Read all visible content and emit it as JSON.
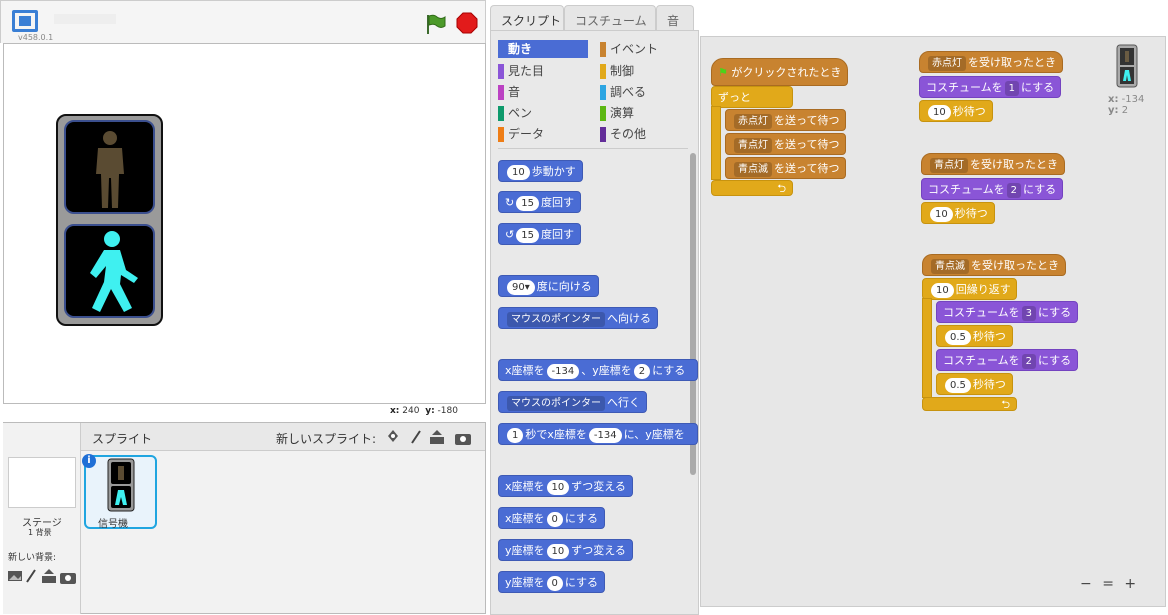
{
  "header": {
    "version": "v458.0.1",
    "flag_icon": "green-flag-icon",
    "stop_icon": "stop-sign-icon"
  },
  "stage": {
    "coords_x_label": "x:",
    "coords_x": "240",
    "coords_y_label": "y:",
    "coords_y": "-180"
  },
  "sprites": {
    "label": "スプライト",
    "new_sprite": "新しいスプライト:",
    "stage_name": "ステージ",
    "stage_count": "1 背景",
    "new_bg": "新しい背景:",
    "items": [
      {
        "name": "信号機"
      }
    ]
  },
  "tabs": [
    {
      "label": "スクリプト"
    },
    {
      "label": "コスチューム"
    },
    {
      "label": "音"
    }
  ],
  "categories": [
    {
      "label": "動き",
      "color": "#4a6cd4"
    },
    {
      "label": "見た目",
      "color": "#8a55d7"
    },
    {
      "label": "音",
      "color": "#bb42c3"
    },
    {
      "label": "ペン",
      "color": "#0e9a6c"
    },
    {
      "label": "データ",
      "color": "#ee7d16"
    },
    {
      "label": "イベント",
      "color": "#c88330"
    },
    {
      "label": "制御",
      "color": "#e1a91a"
    },
    {
      "label": "調べる",
      "color": "#2ca5e2"
    },
    {
      "label": "演算",
      "color": "#5cb712"
    },
    {
      "label": "その他",
      "color": "#632d99"
    }
  ],
  "palette": {
    "move": {
      "v": "10",
      "t": "歩動かす"
    },
    "turn_cw": {
      "v": "15",
      "t": "度回す"
    },
    "turn_ccw": {
      "v": "15",
      "t": "度回す"
    },
    "point_dir": {
      "v": "90▾",
      "t": "度に向ける"
    },
    "point_to": {
      "v": "マウスのポインター",
      "t": "へ向ける"
    },
    "goto_xy": {
      "t1": "x座標を",
      "x": "-134",
      "t2": "、y座標を",
      "y": "2",
      "t3": "にする"
    },
    "goto": {
      "v": "マウスのポインター",
      "t": "へ行く"
    },
    "glide": {
      "s": "1",
      "t1": "秒でx座標を",
      "x": "-134",
      "t2": "に、y座標を"
    },
    "change_x": {
      "t1": "x座標を",
      "v": "10",
      "t2": "ずつ変える"
    },
    "set_x": {
      "t1": "x座標を",
      "v": "0",
      "t2": "にする"
    },
    "change_y": {
      "t1": "y座標を",
      "v": "10",
      "t2": "ずつ変える"
    },
    "set_y": {
      "t1": "y座標を",
      "v": "0",
      "t2": "にする"
    }
  },
  "scripts": {
    "flag_hat": "がクリックされたとき",
    "forever": "ずっと",
    "bcast1": {
      "msg": "赤点灯",
      "t": "を送って待つ"
    },
    "bcast2": {
      "msg": "青点灯",
      "t": "を送って待つ"
    },
    "bcast3": {
      "msg": "青点滅",
      "t": "を送って待つ"
    },
    "s2": {
      "hat_msg": "赤点灯",
      "hat_t": "を受け取ったとき",
      "cos_t1": "コスチュームを",
      "cos_v": "1",
      "cos_t2": "にする",
      "wait_v": "10",
      "wait_t": "秒待つ"
    },
    "s3": {
      "hat_msg": "青点灯",
      "hat_t": "を受け取ったとき",
      "cos_t1": "コスチュームを",
      "cos_v": "2",
      "cos_t2": "にする",
      "wait_v": "10",
      "wait_t": "秒待つ"
    },
    "s4": {
      "hat_msg": "青点滅",
      "hat_t": "を受け取ったとき",
      "rep_v": "10",
      "rep_t": "回繰り返す",
      "c1_t1": "コスチュームを",
      "c1_v": "3",
      "c1_t2": "にする",
      "w1_v": "0.5",
      "w1_t": "秒待つ",
      "c2_t1": "コスチュームを",
      "c2_v": "2",
      "c2_t2": "にする",
      "w2_v": "0.5",
      "w2_t": "秒待つ"
    }
  },
  "current_sprite": {
    "x_label": "x:",
    "x": "-134",
    "y_label": "y:",
    "y": "2"
  },
  "zoom": {
    "out": "−",
    "reset": "=",
    "in": "+"
  }
}
